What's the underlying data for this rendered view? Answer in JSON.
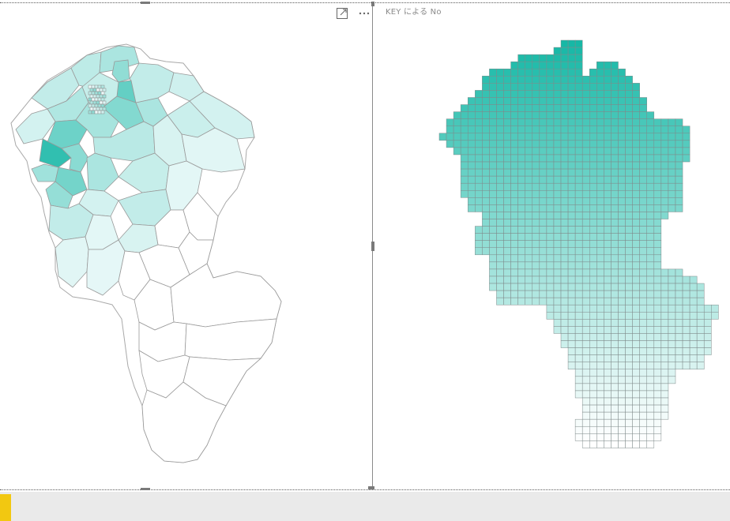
{
  "visuals": {
    "left": {
      "kind": "filled-map",
      "header_icons": [
        "focus-mode-icon",
        "more-options-icon"
      ]
    },
    "right": {
      "kind": "grid-shape-map",
      "title": "KEY による No"
    }
  },
  "colors": {
    "accent": "#16b8a6",
    "low": "#ffffff",
    "region_stroke": "#9e9e9e",
    "grid_stroke": "#7f8a8a",
    "page_background": "#ffffff",
    "status_bar": "#eaeaea",
    "status_accent": "#f2c811"
  }
}
